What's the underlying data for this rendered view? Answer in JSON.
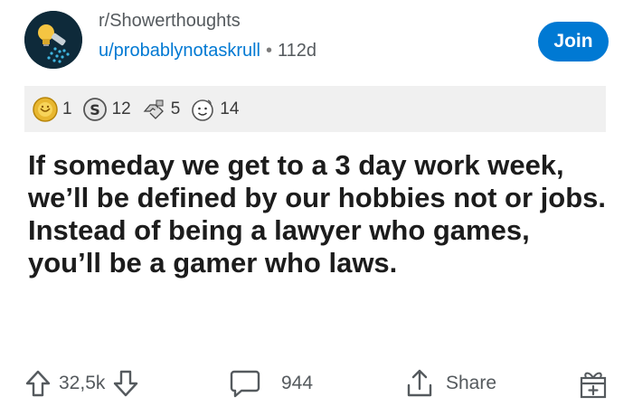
{
  "post": {
    "subreddit": "r/Showerthoughts",
    "author": "u/probablynotaskrull",
    "separator": "•",
    "age": "112d",
    "join_label": "Join",
    "body": "If someday we get to a 3 day work week, we’ll be defined by our hobbies not or jobs. Instead of being a lawyer who games, you’ll be a gamer who laws."
  },
  "awards": [
    {
      "icon": "gold-award-icon",
      "count": "1"
    },
    {
      "icon": "silver-award-icon",
      "count": "12"
    },
    {
      "icon": "helpful-award-icon",
      "count": "5"
    },
    {
      "icon": "wholesome-award-icon",
      "count": "14"
    }
  ],
  "actions": {
    "score": "32,5k",
    "comments": "944",
    "share_label": "Share"
  },
  "colors": {
    "accent": "#0079d3",
    "muted_text": "#555a5e",
    "award_bar_bg": "#f0f0f0"
  }
}
